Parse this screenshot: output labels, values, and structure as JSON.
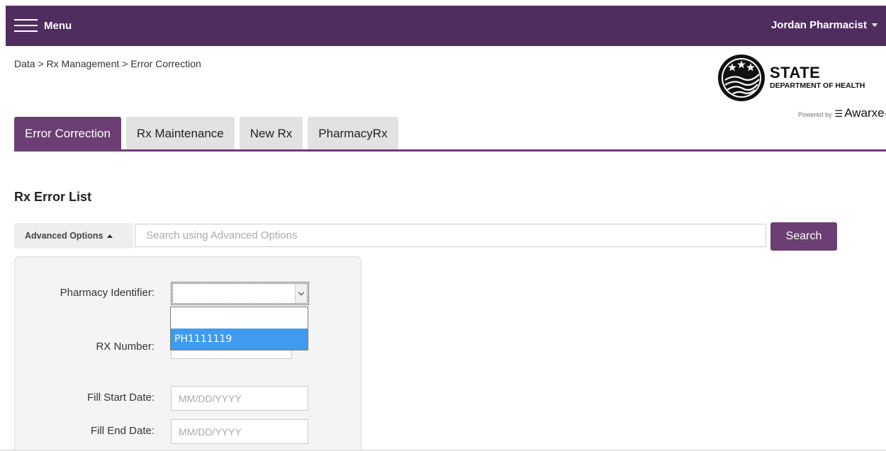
{
  "header": {
    "menu_label": "Menu",
    "user_name": "Jordan Pharmacist"
  },
  "breadcrumb": "Data > Rx Management > Error Correction",
  "logo": {
    "state": "STATE",
    "department": "DEPARTMENT OF HEALTH",
    "powered_by": "Powered by",
    "brand": "Awarxe",
    "trademark": "™"
  },
  "tabs": [
    {
      "label": "Error Correction",
      "active": true
    },
    {
      "label": "Rx Maintenance",
      "active": false
    },
    {
      "label": "New Rx",
      "active": false
    },
    {
      "label": "PharmacyRx",
      "active": false
    }
  ],
  "page_title": "Rx Error List",
  "search": {
    "advanced_options_label": "Advanced Options",
    "placeholder": "Search using Advanced Options",
    "value": "",
    "button_label": "Search"
  },
  "filters": {
    "pharmacy_identifier": {
      "label": "Pharmacy Identifier:",
      "value": "",
      "options": [
        "",
        "PH1111119"
      ],
      "highlighted_option": "PH1111119",
      "expanded": true
    },
    "rx_number": {
      "label": "RX Number:",
      "value": ""
    },
    "fill_start_date": {
      "label": "Fill Start Date:",
      "placeholder": "MM/DD/YYYY",
      "value": ""
    },
    "fill_end_date": {
      "label": "Fill End Date:",
      "placeholder": "MM/DD/YYYY",
      "value": ""
    }
  },
  "colors": {
    "header_bg": "#4f2d5f",
    "accent": "#6b3f73",
    "dropdown_highlight": "#3f9bef"
  },
  "icons": {
    "menu": "hamburger-icon",
    "user_caret": "caret-down-icon",
    "advanced_caret": "caret-up-icon",
    "select": "chevron-down-icon",
    "seal": "state-seal-logo"
  }
}
